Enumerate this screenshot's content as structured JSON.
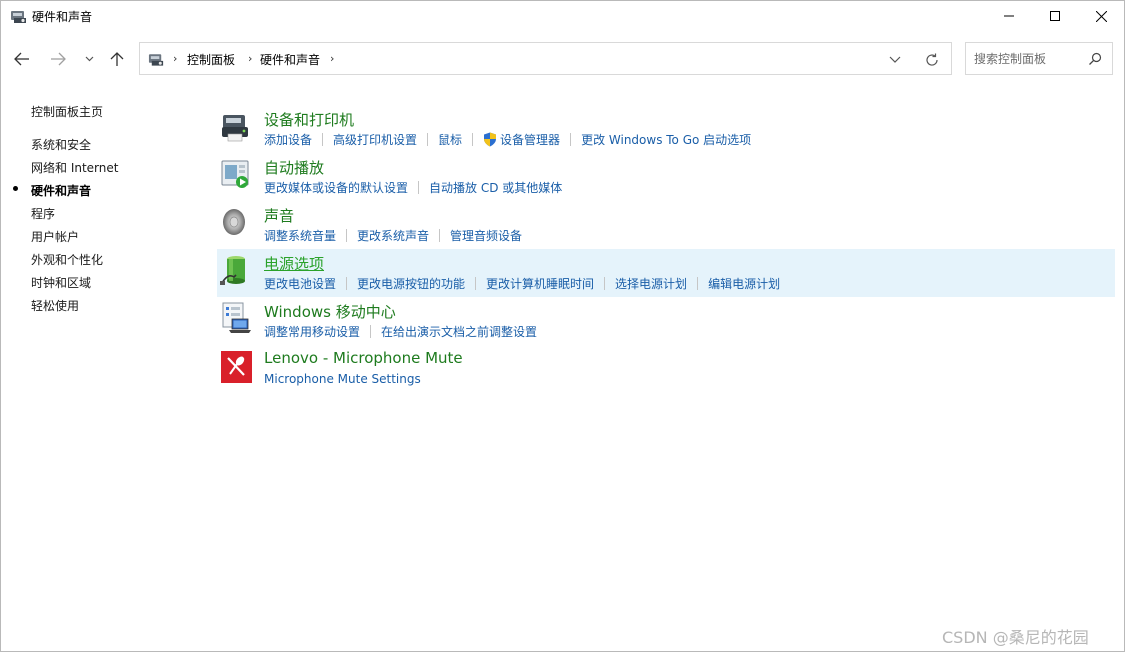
{
  "window": {
    "title": "硬件和声音"
  },
  "address": {
    "crumbs": [
      "控制面板",
      "硬件和声音"
    ]
  },
  "search": {
    "placeholder": "搜索控制面板"
  },
  "sidebar": {
    "items": [
      {
        "label": "控制面板主页"
      },
      {
        "label": "系统和安全"
      },
      {
        "label": "网络和 Internet"
      },
      {
        "label": "硬件和声音",
        "current": true
      },
      {
        "label": "程序"
      },
      {
        "label": "用户帐户"
      },
      {
        "label": "外观和个性化"
      },
      {
        "label": "时钟和区域"
      },
      {
        "label": "轻松使用"
      }
    ]
  },
  "categories": [
    {
      "title": "设备和打印机",
      "icon": "printer-icon",
      "links": [
        "添加设备",
        "高级打印机设置",
        "鼠标",
        "设备管理器",
        "更改 Windows To Go 启动选项"
      ]
    },
    {
      "title": "自动播放",
      "icon": "autoplay-icon",
      "links": [
        "更改媒体或设备的默认设置",
        "自动播放 CD 或其他媒体"
      ]
    },
    {
      "title": "声音",
      "icon": "speaker-icon",
      "links": [
        "调整系统音量",
        "更改系统声音",
        "管理音频设备"
      ]
    },
    {
      "title": "电源选项",
      "icon": "battery-icon",
      "hovered": true,
      "links": [
        "更改电池设置",
        "更改电源按钮的功能",
        "更改计算机睡眠时间",
        "选择电源计划",
        "编辑电源计划"
      ]
    },
    {
      "title": "Windows 移动中心",
      "icon": "mobility-center-icon",
      "links": [
        "调整常用移动设置",
        "在给出演示文档之前调整设置"
      ]
    },
    {
      "title": "Lenovo - Microphone Mute",
      "icon": "microphone-mute-icon",
      "links": [
        "Microphone Mute Settings"
      ]
    }
  ],
  "watermark": "CSDN @桑尼的花园",
  "colors": {
    "category_title": "#1e7b1e",
    "link": "#1a5ea8",
    "hover_bg": "#e5f3fb"
  }
}
